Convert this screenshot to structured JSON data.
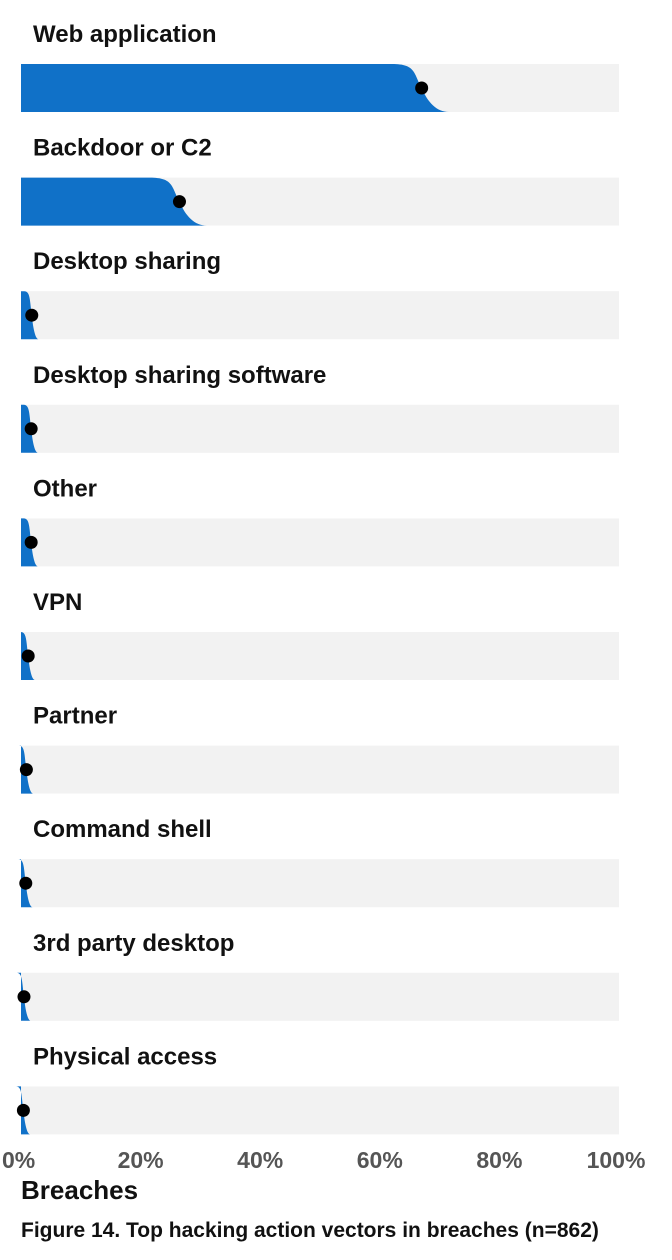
{
  "chart_data": {
    "type": "bar",
    "orientation": "horizontal",
    "style": "ridgeline / slab interval with point estimate",
    "categories": [
      "Web application",
      "Backdoor or C2",
      "Desktop sharing",
      "Desktop sharing software",
      "Other",
      "VPN",
      "Partner",
      "Command shell",
      "3rd party desktop",
      "Physical access"
    ],
    "values": [
      67,
      26.5,
      1.8,
      1.7,
      1.7,
      1.2,
      0.9,
      0.8,
      0.5,
      0.4
    ],
    "xlim": [
      0,
      100
    ],
    "x_ticks": [
      "0%",
      "20%",
      "40%",
      "60%",
      "80%",
      "100%"
    ],
    "xlabel": "Breaches",
    "ylabel": "",
    "title": "",
    "grid": false,
    "legend": "none",
    "colors": {
      "bar": "#1071c8",
      "track": "#f2f2f2",
      "point": "#000000",
      "text": "#111111",
      "tick": "#555555"
    }
  },
  "caption": "Figure 14. Top hacking action vectors in breaches (n=862)"
}
